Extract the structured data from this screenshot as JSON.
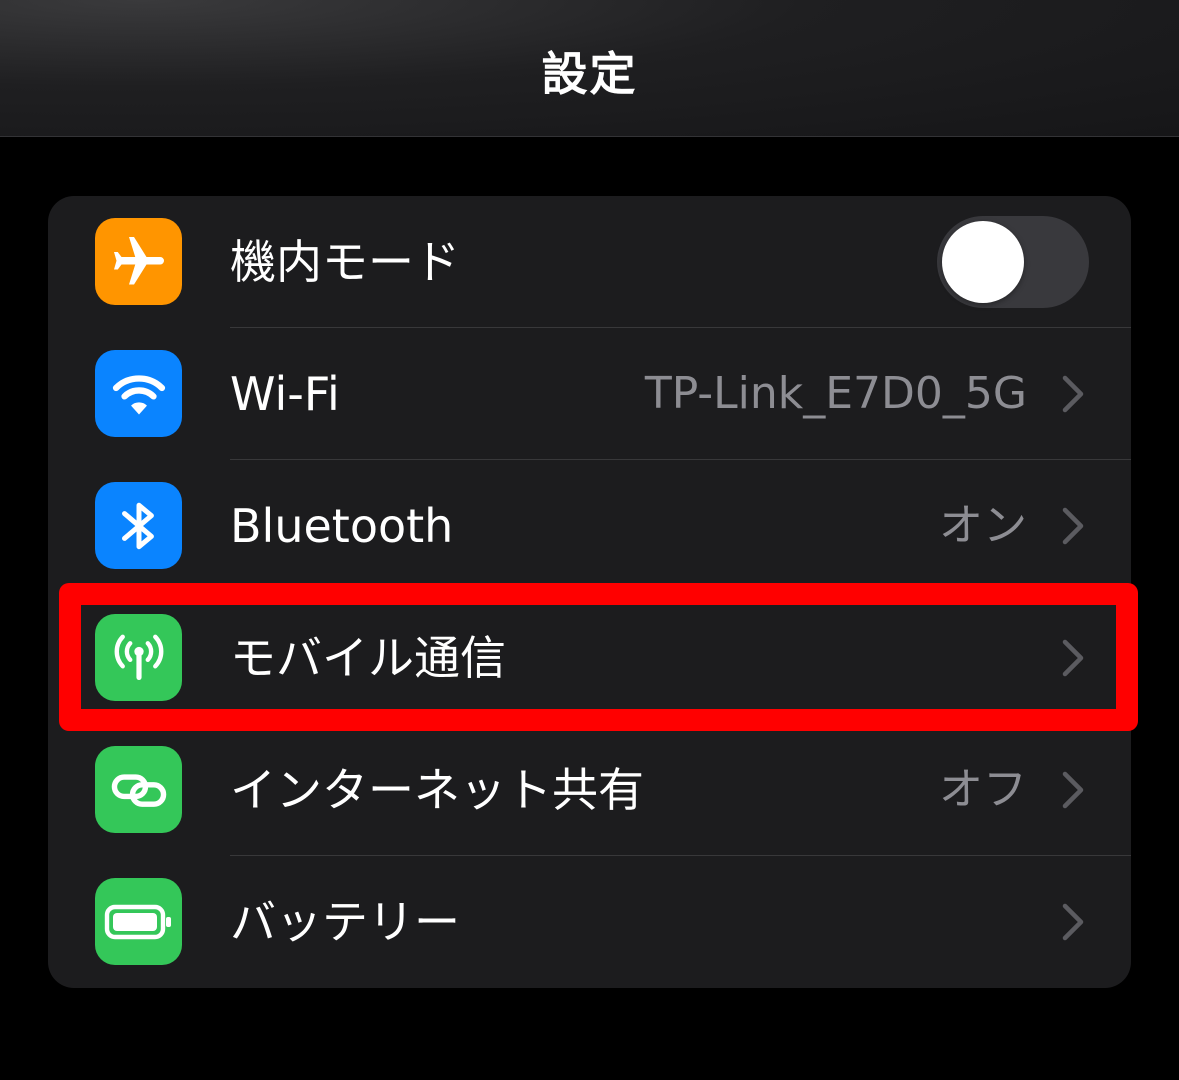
{
  "navbar": {
    "title": "設定"
  },
  "settings": {
    "airplane": {
      "label": "機内モード",
      "icon": "airplane-icon",
      "icon_color": "#ff9500",
      "toggle_on": false
    },
    "wifi": {
      "label": "Wi-Fi",
      "value": "TP-Link_E7D0_5G",
      "icon": "wifi-icon",
      "icon_color": "#0a84ff"
    },
    "bluetooth": {
      "label": "Bluetooth",
      "value": "オン",
      "icon": "bluetooth-icon",
      "icon_color": "#0a84ff"
    },
    "mobile": {
      "label": "モバイル通信",
      "value": "",
      "icon": "antenna-icon",
      "icon_color": "#34c759",
      "highlighted": true
    },
    "hotspot": {
      "label": "インターネット共有",
      "value": "オフ",
      "icon": "link-icon",
      "icon_color": "#34c759"
    },
    "battery": {
      "label": "バッテリー",
      "value": "",
      "icon": "battery-icon",
      "icon_color": "#34c759"
    }
  },
  "colors": {
    "background": "#000000",
    "group_background": "#1c1c1e",
    "highlight": "#ff0000",
    "secondary_text": "#8d8d93"
  }
}
